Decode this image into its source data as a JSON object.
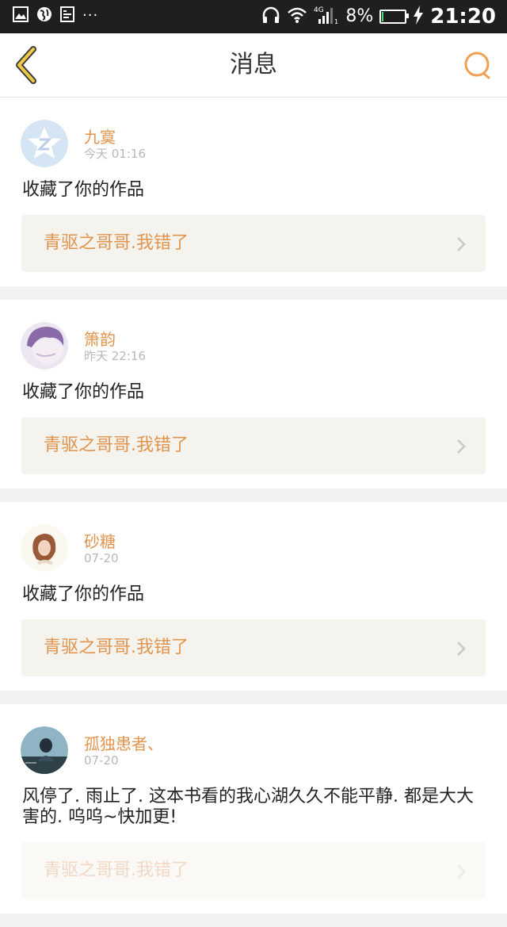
{
  "status_bar": {
    "time": "21:20",
    "battery": "8%",
    "battery_fill": 0.08,
    "notification_dots": "···",
    "icons": [
      "image-icon",
      "globe-icon",
      "screenshot-icon",
      "headset-icon",
      "wifi-icon",
      "signal-4g-icon",
      "battery-icon",
      "charging-icon"
    ]
  },
  "nav": {
    "title": "消息",
    "back_icon": "chevron-left-icon",
    "search_icon": "search-icon",
    "accent_color": "#f0a050"
  },
  "messages": [
    {
      "user": "九寞",
      "time": "今天 01:16",
      "text": "收藏了你的作品",
      "work_title": "青驱之哥哥.我错了",
      "avatar": "qzone-default-avatar"
    },
    {
      "user": "箫韵",
      "time": "昨天 22:16",
      "text": "收藏了你的作品",
      "work_title": "青驱之哥哥.我错了",
      "avatar": "purple-hair-avatar"
    },
    {
      "user": "砂糖",
      "time": "07-20",
      "text": "收藏了你的作品",
      "work_title": "青驱之哥哥.我错了",
      "avatar": "girl-portrait-avatar"
    },
    {
      "user": "孤独患者、",
      "time": "07-20",
      "text": "风停了. 雨止了. 这本书看的我心湖久久不能平静. 都是大大害的. 呜呜~快加更!",
      "work_title": "青驱之哥哥.我错了",
      "avatar": "photo-avatar"
    }
  ]
}
